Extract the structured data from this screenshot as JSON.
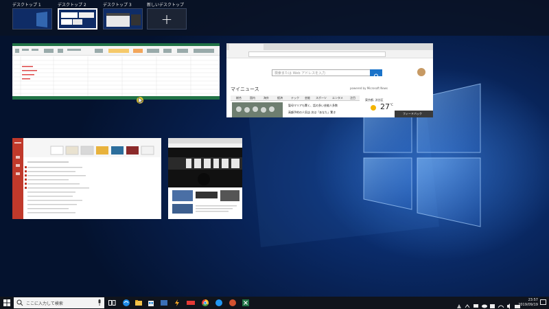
{
  "desktops": [
    {
      "label": "デスクトップ 1"
    },
    {
      "label": "デスクトップ 2"
    },
    {
      "label": "デスクトップ 3"
    },
    {
      "label": "新しいデスクトップ",
      "plus": "+"
    }
  ],
  "edge_window": {
    "search_placeholder": "検索または Web アドレスを入力",
    "news_header": "マイニュース",
    "powered_by": "powered by Microsoft News",
    "news_tabs": [
      "総合",
      "国内",
      "海外",
      "経済",
      "テック",
      "芸能",
      "スポーツ",
      "エンタメ",
      "注目"
    ],
    "headlines": [
      "聖母マリアも驚く、話の多い芸能人多数",
      "高額予約の人気店 次は「あなた」驚き"
    ],
    "weather_city": "東京都, 渋谷区",
    "weather_temp": "27",
    "weather_unit": "°C",
    "feedback": "フィードバック"
  },
  "taskbar": {
    "search_placeholder": "ここに入力して検索",
    "time": "23:57",
    "date": "2019/09/19"
  }
}
